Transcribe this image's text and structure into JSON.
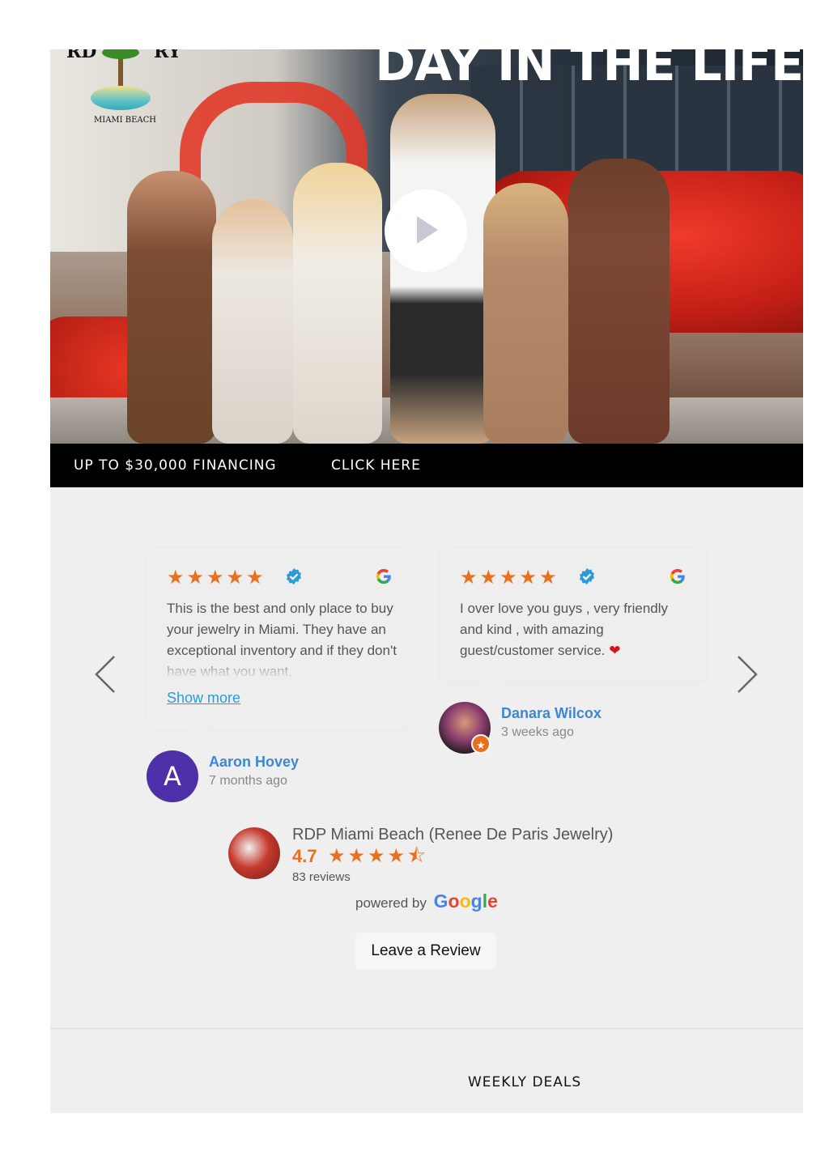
{
  "hero": {
    "title": "DAY IN THE LIFE",
    "logo_arc_left": "RD",
    "logo_arc_right": "RY",
    "logo_subtitle": "MIAMI BEACH",
    "play_icon": "play-icon"
  },
  "banner": {
    "financing": "UP TO $30,000 FINANCING",
    "cta": "CLICK HERE"
  },
  "reviews": {
    "prev_icon": "chevron-left-icon",
    "next_icon": "chevron-right-icon",
    "star_color": "#e8701e",
    "items": [
      {
        "rating": 5,
        "text": "This is the best and only place to buy your jewelry in Miami. They have an exceptional inventory and if they don't have what you want,",
        "show_more": "Show more",
        "name": "Aaron Hovey",
        "date": "7 months ago",
        "avatar_letter": "A",
        "avatar_color": "#4d2fa8"
      },
      {
        "rating": 5,
        "text": "I over love you guys , very friendly and kind , with amazing guest/customer service.",
        "emoji": "❤",
        "name": "Danara Wilcox",
        "date": "3 weeks ago"
      }
    ],
    "summary": {
      "business": "RDP Miami Beach (Renee De Paris Jewelry)",
      "rating": "4.7",
      "count": "83 reviews"
    },
    "powered_by": "powered by",
    "leave_review": "Leave a Review"
  },
  "deals": {
    "label": "WEEKLY DEALS"
  }
}
